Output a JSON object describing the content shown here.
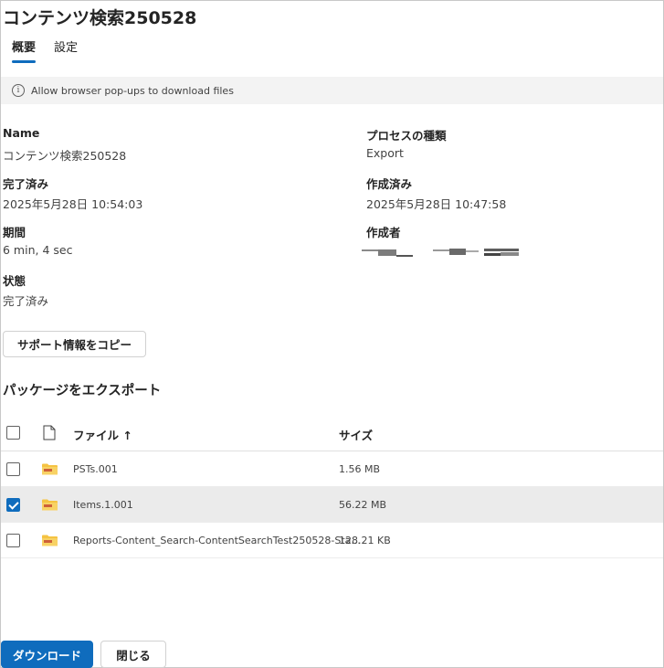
{
  "header": {
    "title": "コンテンツ検索250528"
  },
  "tabs": [
    {
      "label": "概要",
      "active": true
    },
    {
      "label": "設定",
      "active": false
    }
  ],
  "infobar": {
    "icon": "info-icon",
    "text": "Allow browser pop-ups to download files"
  },
  "details": {
    "name_label": "Name",
    "name_value": "コンテンツ検索250528",
    "completed_label": "完了済み",
    "completed_value": "2025年5月28日 10:54:03",
    "duration_label": "期間",
    "duration_value": "6 min, 4 sec",
    "status_label": "状態",
    "status_value": "完了済み",
    "process_label": "プロセスの種類",
    "process_value": "Export",
    "created_label": "作成済み",
    "created_value": "2025年5月28日 10:47:58",
    "creator_label": "作成者"
  },
  "copy_support_button": "サポート情報をコピー",
  "export_section": {
    "title": "パッケージをエクスポート",
    "columns": {
      "file": "ファイル ↑",
      "size": "サイズ"
    },
    "rows": [
      {
        "name": "PSTs.001",
        "size": "1.56 MB",
        "checked": false
      },
      {
        "name": "Items.1.001",
        "size": "56.22 MB",
        "checked": true
      },
      {
        "name": "Reports-Content_Search-ContentSearchTest250528-Sta...",
        "size": "128.21 KB",
        "checked": false
      }
    ]
  },
  "footer": {
    "download_button": "ダウンロード",
    "close_button": "閉じる"
  },
  "colors": {
    "accent": "#0f6cbd",
    "folder": "#f5c342",
    "selected_row": "#ebebeb"
  }
}
